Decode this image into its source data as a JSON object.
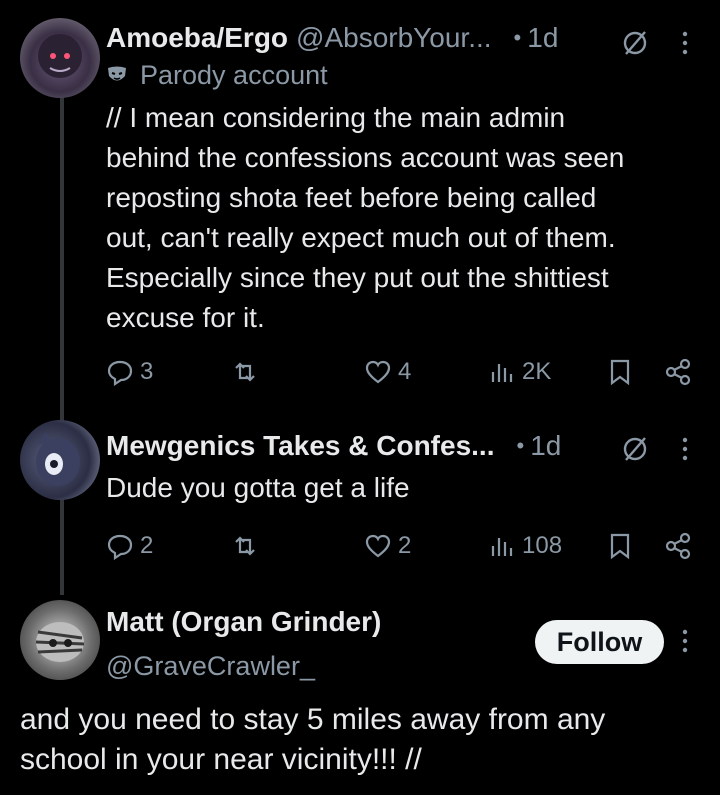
{
  "tweets": [
    {
      "display_name": "Amoeba/Ergo",
      "handle": "@AbsorbYour...",
      "time": "1d",
      "parody_label": "Parody account",
      "text": "// I mean considering the main admin\nbehind the confessions account was seen\nreposting shota feet before being called\nout, can't really expect much out of them.\nEspecially since they put out the shittiest\nexcuse for it.",
      "replies": "3",
      "reposts": "",
      "likes": "4",
      "views": "2K"
    },
    {
      "display_name": "Mewgenics Takes & Confes...",
      "time": "1d",
      "text": "Dude you gotta get a life",
      "replies": "2",
      "reposts": "",
      "likes": "2",
      "views": "108"
    }
  ],
  "focused": {
    "display_name": "Matt (Organ Grinder)",
    "handle": "@GraveCrawler_",
    "follow_label": "Follow",
    "text": "and you need to stay 5 miles away from any\nschool in your near vicinity!!! //"
  },
  "icons": {
    "reply": "reply-icon",
    "repost": "repost-icon",
    "like": "heart-icon",
    "views": "views-icon",
    "bookmark": "bookmark-icon",
    "share": "share-icon",
    "grok": "grok-icon",
    "more": "more-icon",
    "parody": "mask-icon"
  },
  "colors": {
    "background": "#000000",
    "text_primary": "#e7e9ea",
    "text_secondary": "#8b98a5",
    "thread_line": "#333639",
    "follow_bg": "#eff3f4"
  }
}
